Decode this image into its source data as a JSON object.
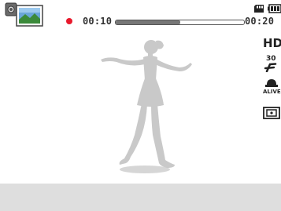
{
  "recording": {
    "elapsed": "00:10",
    "total": "00:20",
    "progress": 0.5,
    "indicator_color": "#e8192c"
  },
  "status": {
    "resolution": "HD",
    "frame_rate": "30",
    "icons": [
      "movie-mode-icon",
      "memory-card-icon",
      "battery-icon",
      "fps-icon",
      "smart-alive-icon",
      "metering-icon"
    ]
  },
  "colors": {
    "background": "#ffffff",
    "bottom_bar": "#dedede",
    "silhouette": "#c9c9c9"
  }
}
